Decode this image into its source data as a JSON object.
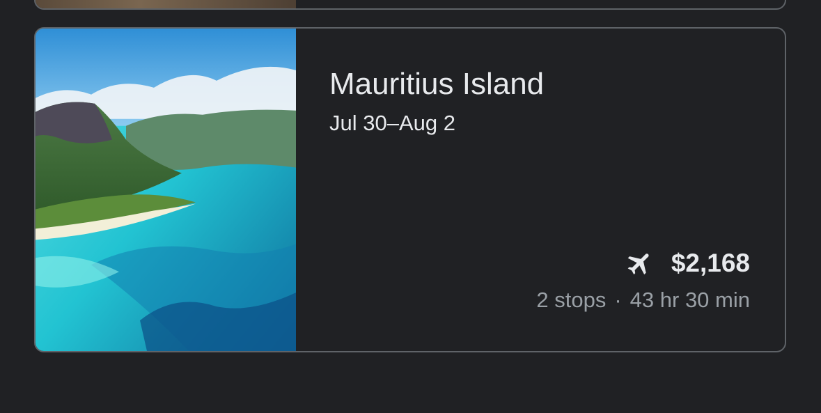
{
  "previous_card": {},
  "destination_card": {
    "title": "Mauritius Island",
    "dates": "Jul 30–Aug 2",
    "price": "$2,168",
    "stops": "2 stops",
    "separator": "·",
    "duration": "43 hr 30 min",
    "icon": "airplane-icon"
  }
}
